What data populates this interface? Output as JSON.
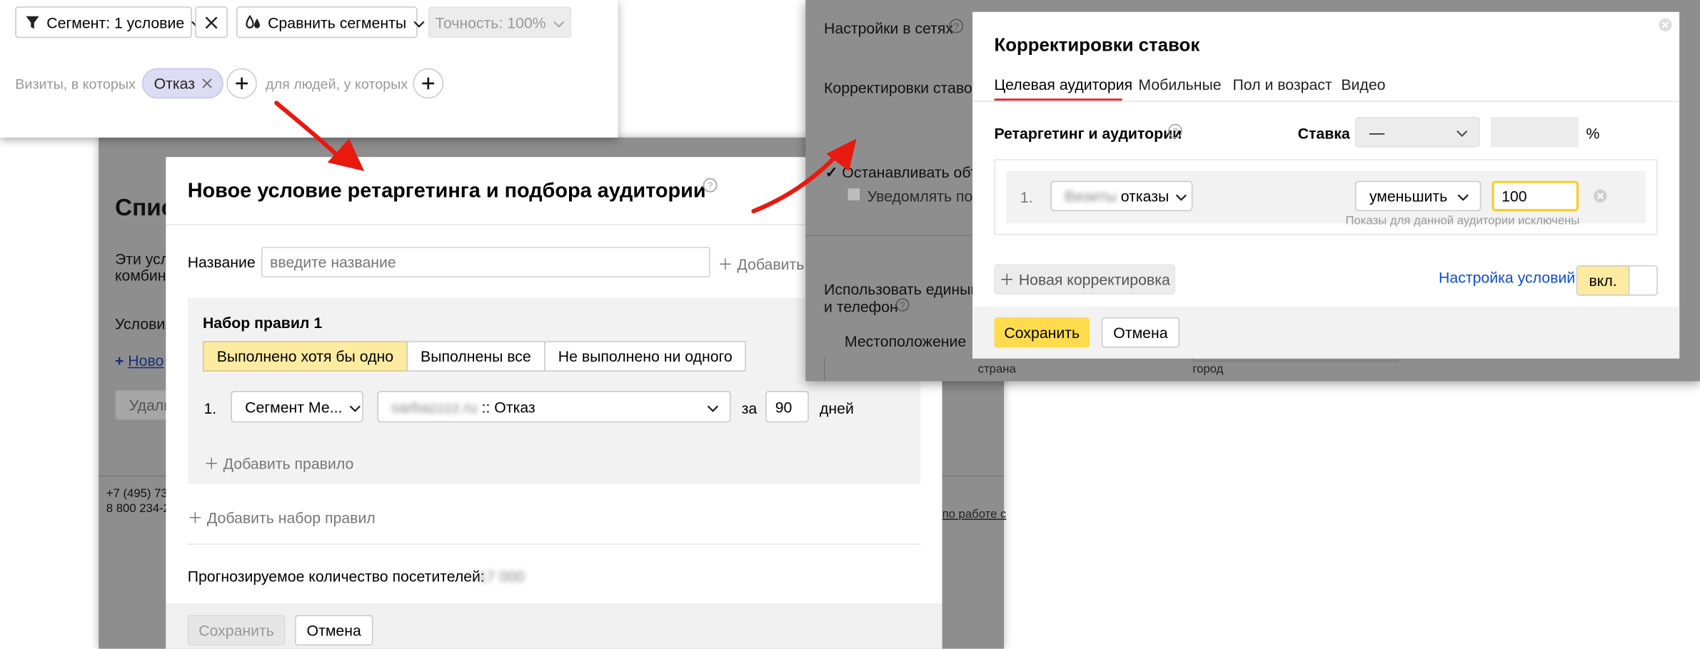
{
  "segment_bar": {
    "segment_label": "Сегмент: 1 условие",
    "compare_label": "Сравнить сегменты",
    "accuracy_label": "Точность: 100%",
    "visits_label": "Визиты, в которых",
    "chip_label": "Отказ",
    "people_label": "для людей, у которых"
  },
  "background_page": {
    "heading_partial": "Спис",
    "desc_line1": "Эти усло",
    "desc_line2": "комбина",
    "conditions_partial": "Условия",
    "new_link_partial": "Ново",
    "delete_partial": "Удали",
    "phone1_partial": "+7 (495) 73",
    "phone2_partial": "8 800 234-2",
    "right_link_partial": "по работе с"
  },
  "retargeting_dialog": {
    "title": "Новое условие ретаргетинга и подбора аудитории",
    "name_label": "Название",
    "name_placeholder": "введите название",
    "add_partial": "Добавить",
    "ruleset_title": "Набор правил 1",
    "options": [
      "Выполнено хотя бы одно",
      "Выполнены все",
      "Не выполнено ни одного"
    ],
    "rule_index": "1.",
    "rule_type": "Сегмент Ме...",
    "rule_goal_blurred": "sarbazzzz.ru",
    "rule_goal_suffix": ":: Отказ",
    "for_label": "за",
    "days_value": "90",
    "days_label": "дней",
    "add_rule": "Добавить правило",
    "add_ruleset": "Добавить набор правил",
    "forecast_label": "Прогнозируемое количество посетителей:",
    "forecast_value_blurred": "17 000",
    "save": "Сохранить",
    "cancel": "Отмена"
  },
  "right_page": {
    "network_settings": "Настройки в сетях",
    "bid_adjust_partial": "Корректировки ставок",
    "stop_partial": "Останавливать объ",
    "notify_partial": "Уведомлять по С",
    "single_line1": "Использовать единый",
    "single_line2": "и телефон",
    "location": "Местоположение",
    "country": "страна",
    "city": "город"
  },
  "bid_dialog": {
    "title": "Корректировки ставок",
    "tabs": [
      "Целевая аудитория",
      "Мобильные",
      "Пол и возраст",
      "Видео"
    ],
    "section_label": "Ретаргетинг и аудитории",
    "bid_label": "Ставка",
    "bid_select": "—",
    "percent": "%",
    "row_index": "1.",
    "audience_blurred": "Визиты",
    "audience_suffix": "отказы",
    "action": "уменьшить",
    "value": "100",
    "hint": "Показы для данной аудитории исключены",
    "new_adjust": "Новая корректировка",
    "condition_settings": "Настройка условий",
    "toggle_on": "вкл.",
    "save": "Сохранить",
    "cancel": "Отмена"
  },
  "colors": {
    "accent_yellow": "#ffdb4d",
    "active_option": "#fdeba1",
    "link_blue": "#0d4cd3",
    "arrow_red": "#e8190f",
    "overlay_gray": "#8e8e8e"
  }
}
